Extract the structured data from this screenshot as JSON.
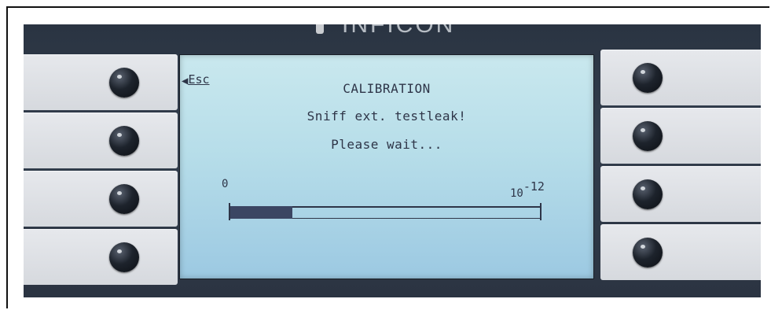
{
  "device": {
    "brand": "INFICON",
    "colors": {
      "screen": "#b6dde9",
      "text": "#2e3548",
      "bar_fill": "#3b4663",
      "panel": "#2f3948",
      "key": "#dcdfe3"
    }
  },
  "display": {
    "esc_label": "Esc",
    "title": "CALIBRATION",
    "message": "Sniff ext. testleak!",
    "status": "Please wait...",
    "scale_min": "0",
    "scale_max_base": "10",
    "scale_max_exp": "-12",
    "progress_fraction": 0.2
  },
  "left_keys": [
    {
      "icon": "key-knob"
    },
    {
      "icon": "key-knob"
    },
    {
      "icon": "key-knob"
    },
    {
      "icon": "key-knob"
    }
  ],
  "right_keys": [
    {
      "icon": "key-knob"
    },
    {
      "icon": "key-knob"
    },
    {
      "icon": "key-knob"
    },
    {
      "icon": "key-knob"
    }
  ]
}
